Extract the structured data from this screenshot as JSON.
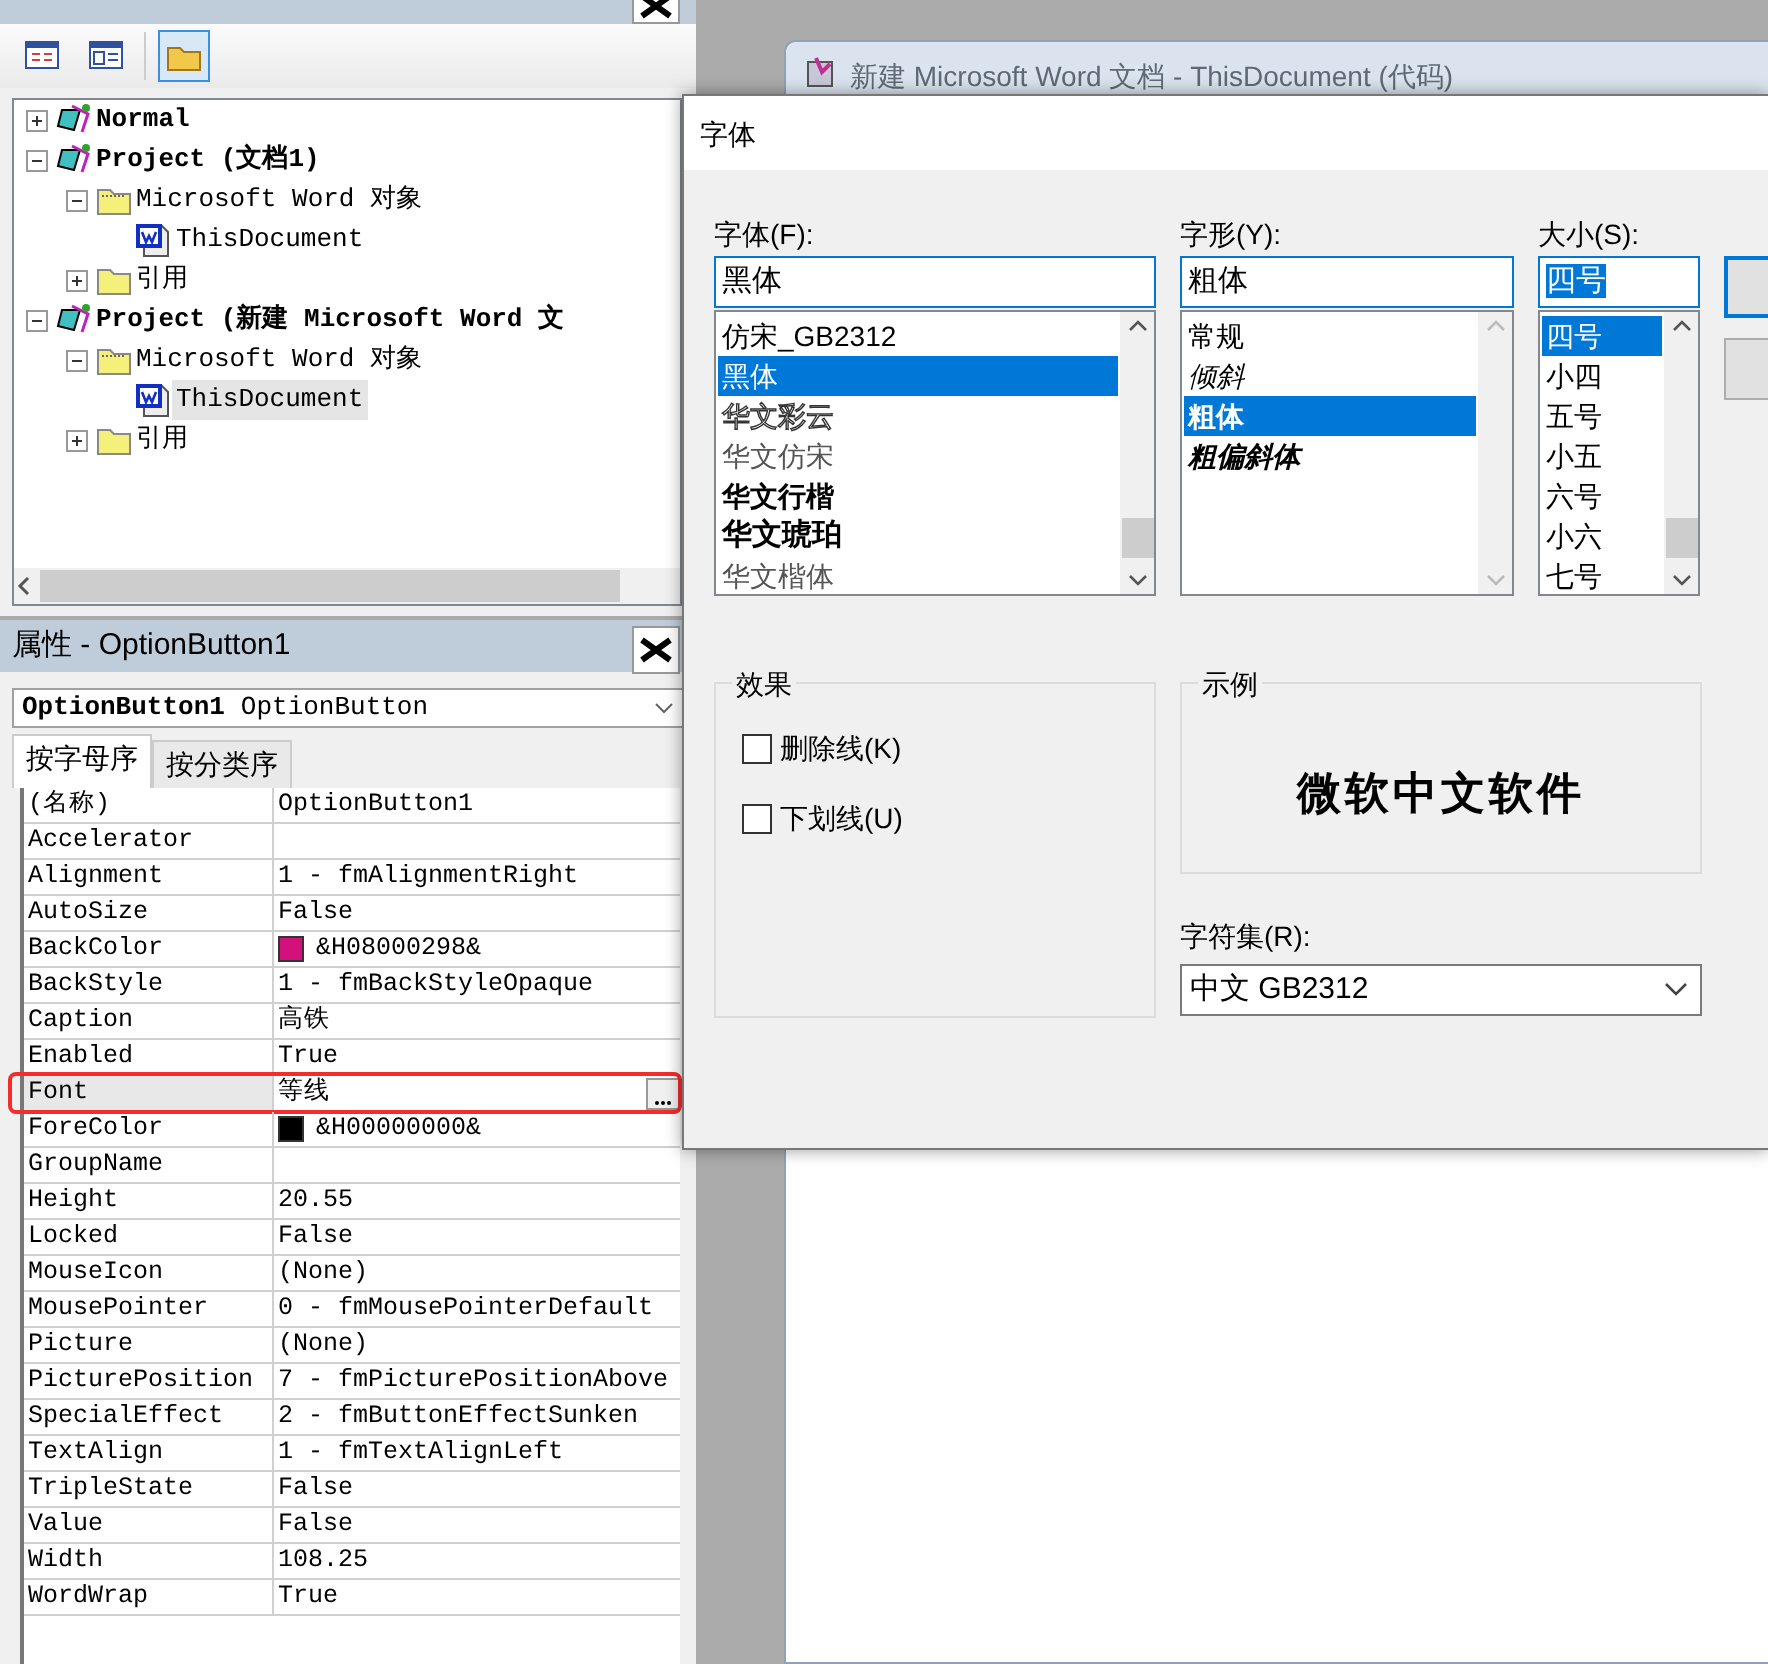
{
  "project_pane": {
    "toolbar": [
      {
        "kind": "code",
        "selected": false
      },
      {
        "kind": "object",
        "selected": false
      },
      {
        "kind": "folders",
        "selected": true
      }
    ],
    "tree": [
      {
        "label": "Normal",
        "kind": "project",
        "expanded": false,
        "selected": false
      },
      {
        "label": "Project (文档1)",
        "kind": "project",
        "expanded": true,
        "selected": false,
        "children": [
          {
            "label": "Microsoft Word 对象",
            "kind": "folder",
            "expanded": true,
            "selected": false,
            "children": [
              {
                "label": "ThisDocument",
                "kind": "document",
                "selected": false
              }
            ]
          },
          {
            "label": "引用",
            "kind": "references",
            "expanded": false,
            "selected": false
          }
        ]
      },
      {
        "label": "Project (新建 Microsoft Word 文",
        "kind": "project",
        "expanded": true,
        "selected": false,
        "children": [
          {
            "label": "Microsoft Word 对象",
            "kind": "folder",
            "expanded": true,
            "selected": false,
            "children": [
              {
                "label": "ThisDocument",
                "kind": "document",
                "selected": true
              }
            ]
          },
          {
            "label": "引用",
            "kind": "references",
            "expanded": false,
            "selected": false
          }
        ]
      }
    ]
  },
  "properties_pane": {
    "title": "属性 - OptionButton1",
    "object": {
      "name": "OptionButton1",
      "type": "OptionButton"
    },
    "tabs": [
      {
        "label": "按字母序",
        "selected": true
      },
      {
        "label": "按分类序",
        "selected": false
      }
    ],
    "rows": [
      {
        "name": "(名称)",
        "value": "OptionButton1",
        "selected": false,
        "highlighted": false
      },
      {
        "name": "Accelerator",
        "selected": false,
        "highlighted": false
      },
      {
        "name": "Alignment",
        "value": "1 - fmAlignmentRight",
        "selected": false,
        "highlighted": false
      },
      {
        "name": "AutoSize",
        "value": "False",
        "selected": false,
        "highlighted": false
      },
      {
        "name": "BackColor",
        "value": "&H08000298&",
        "color": "#d4107c",
        "selected": false,
        "highlighted": false
      },
      {
        "name": "BackStyle",
        "value": "1 - fmBackStyleOpaque",
        "selected": false,
        "highlighted": false
      },
      {
        "name": "Caption",
        "value": "高铁",
        "selected": false,
        "highlighted": false
      },
      {
        "name": "Enabled",
        "value": "True",
        "selected": false,
        "highlighted": false
      },
      {
        "name": "Font",
        "value": "等线",
        "selected": true,
        "highlighted": true
      },
      {
        "name": "ForeColor",
        "value": "&H00000000&",
        "color": "#000000",
        "selected": false,
        "highlighted": false
      },
      {
        "name": "GroupName",
        "selected": false,
        "highlighted": false
      },
      {
        "name": "Height",
        "value": "20.55",
        "selected": false,
        "highlighted": false
      },
      {
        "name": "Locked",
        "value": "False",
        "selected": false,
        "highlighted": false
      },
      {
        "name": "MouseIcon",
        "value": "(None)",
        "selected": false,
        "highlighted": false
      },
      {
        "name": "MousePointer",
        "value": "0 - fmMousePointerDefault",
        "selected": false,
        "highlighted": false
      },
      {
        "name": "Picture",
        "value": "(None)",
        "selected": false,
        "highlighted": false
      },
      {
        "name": "PicturePosition",
        "value": "7 - fmPicturePositionAbove",
        "selected": false,
        "highlighted": false
      },
      {
        "name": "SpecialEffect",
        "value": "2 - fmButtonEffectSunken",
        "selected": false,
        "highlighted": false
      },
      {
        "name": "TextAlign",
        "value": "1 - fmTextAlignLeft",
        "selected": false,
        "highlighted": false
      },
      {
        "name": "TripleState",
        "value": "False",
        "selected": false,
        "highlighted": false
      },
      {
        "name": "Value",
        "value": "False",
        "selected": false,
        "highlighted": false
      },
      {
        "name": "Width",
        "value": "108.25",
        "selected": false,
        "highlighted": false
      },
      {
        "name": "WordWrap",
        "value": "True",
        "selected": false,
        "highlighted": false
      }
    ]
  },
  "code_window": {
    "title": "新建 Microsoft Word 文档 - ThisDocument (代码)"
  },
  "font_dialog": {
    "title": "字体",
    "lists": [
      {
        "label": "字体(F):",
        "value": "黑体",
        "text_selected": false,
        "items": [
          {
            "label": "仿宋_GB2312",
            "kind": "regular",
            "selected": false
          },
          {
            "label": "黑体",
            "kind": "regular",
            "selected": true
          },
          {
            "label": "华文彩云",
            "kind": "outline",
            "selected": false
          },
          {
            "label": "华文仿宋",
            "kind": "light",
            "selected": false
          },
          {
            "label": "华文行楷",
            "kind": "bold",
            "selected": false
          },
          {
            "label": "华文琥珀",
            "kind": "heavy",
            "selected": false
          },
          {
            "label": "华文楷体",
            "kind": "light",
            "selected": false
          }
        ]
      },
      {
        "label": "字形(Y):",
        "value": "粗体",
        "text_selected": false,
        "items": [
          {
            "label": "常规",
            "kind": "regular",
            "selected": false
          },
          {
            "label": "倾斜",
            "kind": "italic",
            "selected": false
          },
          {
            "label": "粗体",
            "kind": "bold",
            "selected": true
          },
          {
            "label": "粗偏斜体",
            "kind": "bold-italic",
            "selected": false
          }
        ]
      },
      {
        "label": "大小(S):",
        "value": "四号",
        "text_selected": true,
        "items": [
          {
            "label": "四号",
            "kind": "regular",
            "selected": true
          },
          {
            "label": "小四",
            "kind": "regular",
            "selected": false
          },
          {
            "label": "五号",
            "kind": "regular",
            "selected": false
          },
          {
            "label": "小五",
            "kind": "regular",
            "selected": false
          },
          {
            "label": "六号",
            "kind": "regular",
            "selected": false
          },
          {
            "label": "小六",
            "kind": "regular",
            "selected": false
          },
          {
            "label": "七号",
            "kind": "regular",
            "selected": false
          }
        ]
      }
    ],
    "effects": {
      "title": "效果",
      "options": [
        {
          "label": "删除线(K)",
          "checked": false
        },
        {
          "label": "下划线(U)",
          "checked": false
        }
      ]
    },
    "sample": {
      "title": "示例",
      "text": "微软中文软件"
    },
    "charset": {
      "label": "字符集(R):",
      "value": "中文 GB2312"
    }
  }
}
